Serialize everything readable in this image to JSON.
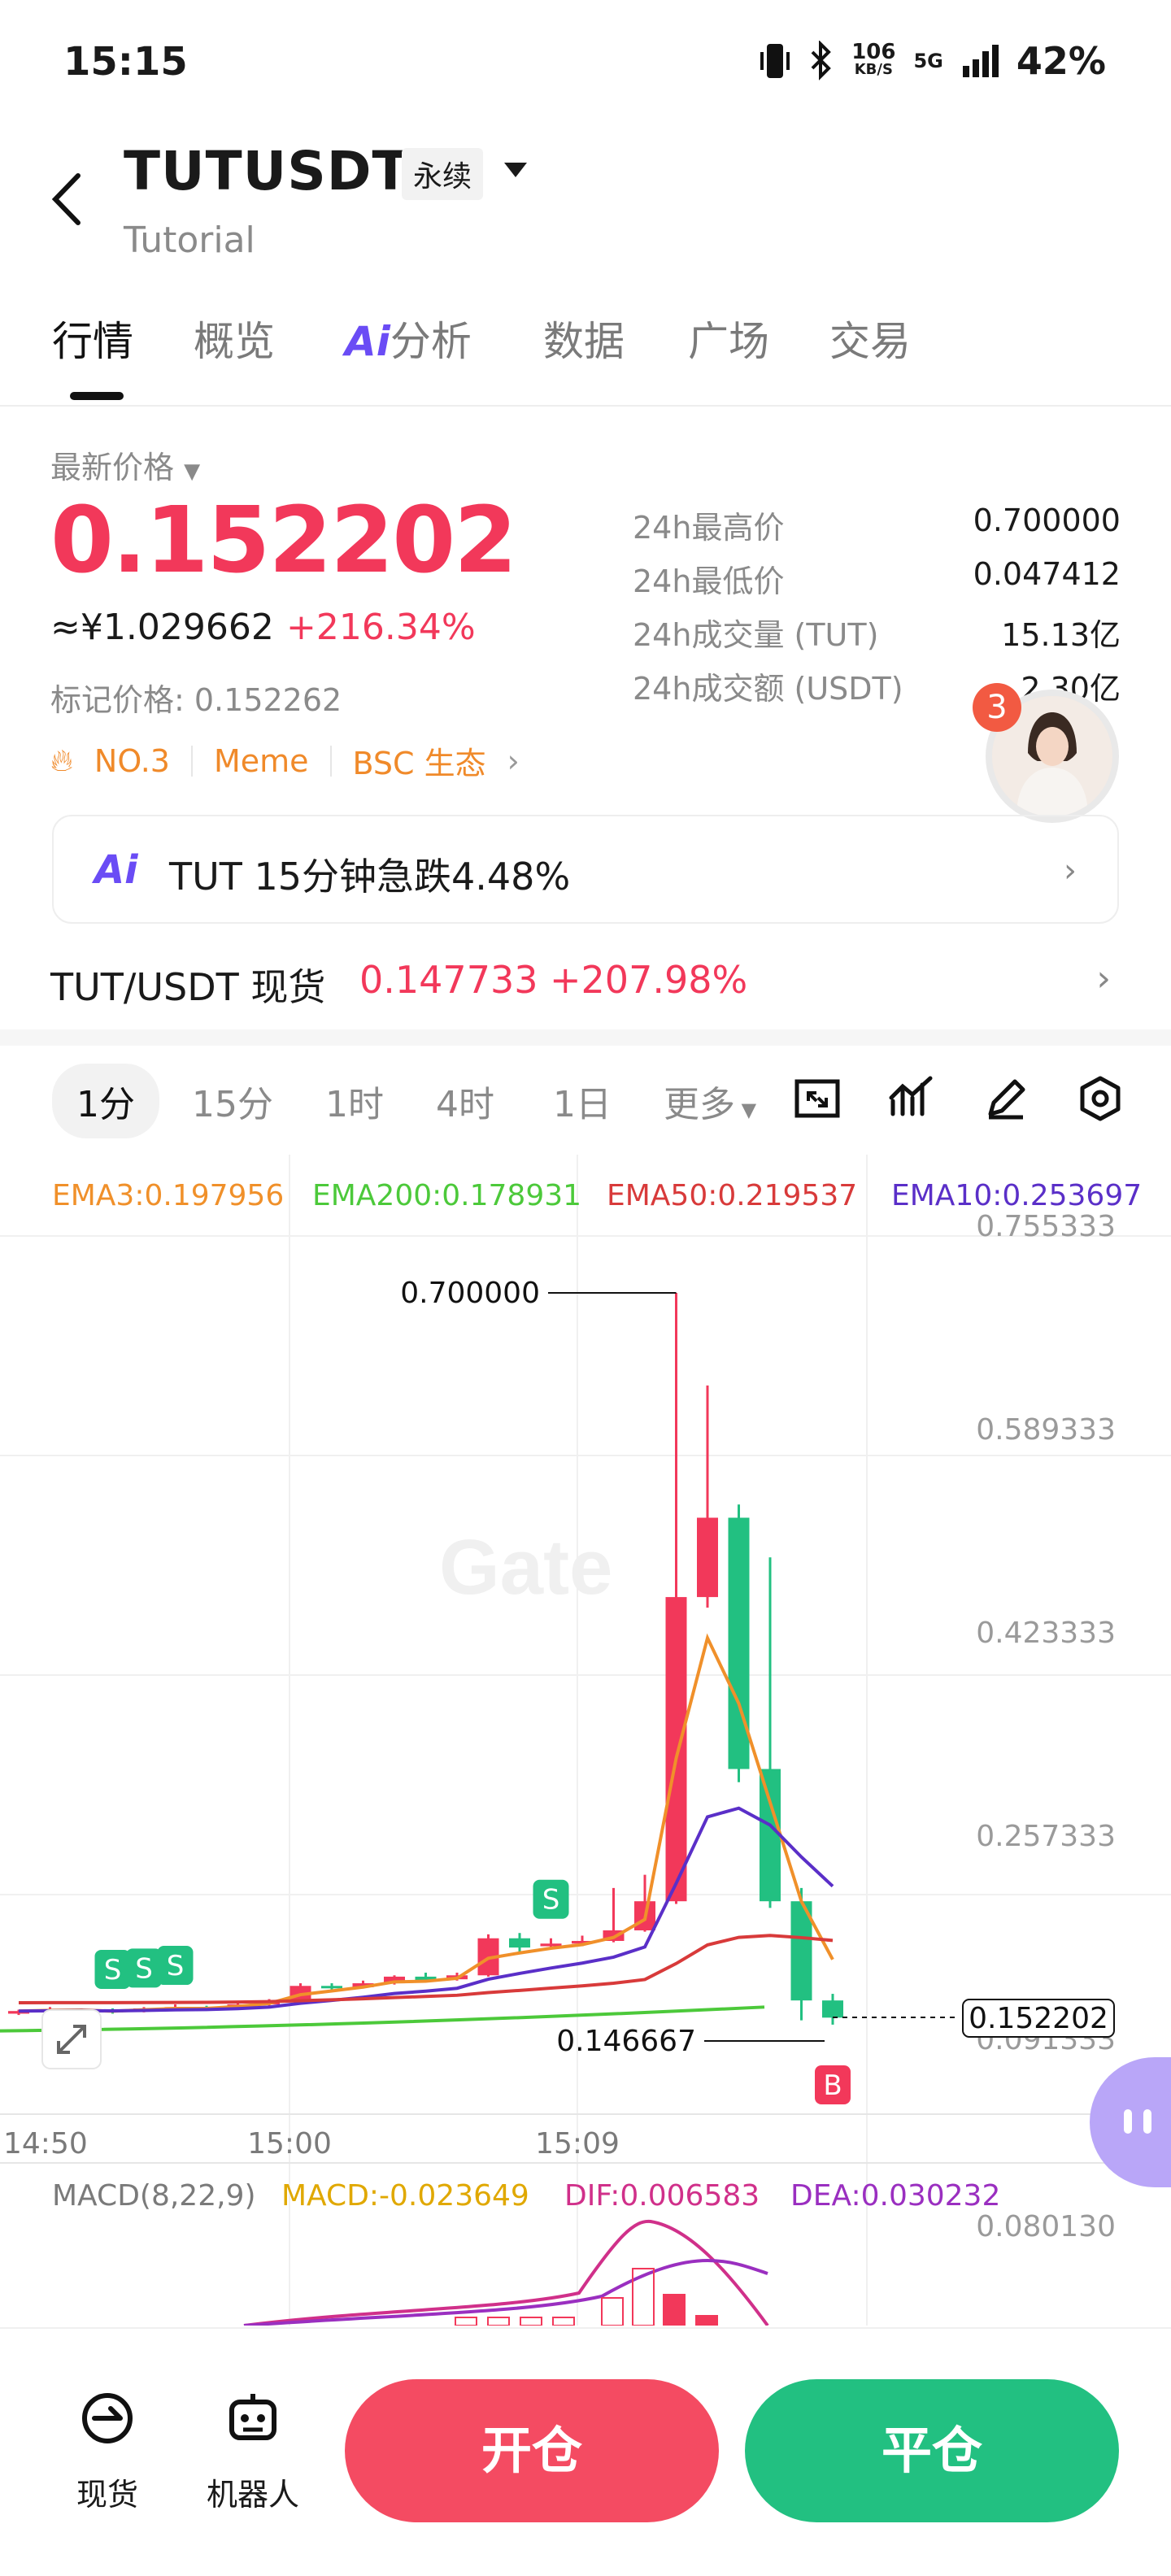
{
  "status": {
    "time": "15:15",
    "netspeed_value": "106",
    "netspeed_unit": "KB/S",
    "network": "5G",
    "battery": "42%"
  },
  "header": {
    "title": "TUTUSDT",
    "contract_type": "永续",
    "subtitle": "Tutorial"
  },
  "tabs": [
    {
      "label": "行情",
      "active": true
    },
    {
      "label": "概览"
    },
    {
      "label": "分析",
      "prefix": "Ai"
    },
    {
      "label": "数据"
    },
    {
      "label": "广场"
    },
    {
      "label": "交易"
    }
  ],
  "price": {
    "latest_label": "最新价格",
    "latest": "0.152202",
    "cny": "≈¥1.029662",
    "change": "+216.34%",
    "mark_label": "标记价格: 0.152262",
    "tags": [
      "NO.3",
      "Meme",
      "BSC 生态"
    ],
    "stats": [
      {
        "k": "24h最高价",
        "v": "0.700000"
      },
      {
        "k": "24h最低价",
        "v": "0.047412"
      },
      {
        "k": "24h成交量 (TUT)",
        "v": "15.13亿"
      },
      {
        "k": "24h成交额 (USDT)",
        "v": "2.30亿"
      }
    ]
  },
  "ai_notice": {
    "logo": "Ai",
    "text": "TUT 15分钟急跌4.48%"
  },
  "spot": {
    "name": "TUT/USDT 现货",
    "price": "0.147733",
    "change": "+207.98%"
  },
  "badge_count": "3",
  "intervals": [
    "1分",
    "15分",
    "1时",
    "4时",
    "1日",
    "更多"
  ],
  "chart_data": {
    "type": "candlestick",
    "ema_legend": [
      {
        "name": "EMA3",
        "value": "0.197956",
        "color": "#f0902a"
      },
      {
        "name": "EMA200",
        "value": "0.178931",
        "color": "#4cc93a"
      },
      {
        "name": "EMA50",
        "value": "0.219537",
        "color": "#d83a3a"
      },
      {
        "name": "EMA10",
        "value": "0.253697",
        "color": "#5a2fc8"
      }
    ],
    "y_ticks": [
      "0.755333",
      "0.589333",
      "0.423333",
      "0.257333",
      "0.091333"
    ],
    "y_range": [
      0.091333,
      0.755333
    ],
    "x_ticks": [
      "14:50",
      "15:00",
      "15:09"
    ],
    "high_label": "0.700000",
    "low_label": "0.146667",
    "last_price_label": "0.152202",
    "watermark": "Gate",
    "candles": [
      {
        "o": 0.155,
        "c": 0.157,
        "h": 0.158,
        "l": 0.154
      },
      {
        "o": 0.156,
        "c": 0.158,
        "h": 0.16,
        "l": 0.155
      },
      {
        "o": 0.157,
        "c": 0.158,
        "h": 0.159,
        "l": 0.156
      },
      {
        "o": 0.158,
        "c": 0.156,
        "h": 0.159,
        "l": 0.155
      },
      {
        "o": 0.157,
        "c": 0.159,
        "h": 0.16,
        "l": 0.156
      },
      {
        "o": 0.158,
        "c": 0.16,
        "h": 0.162,
        "l": 0.157
      },
      {
        "o": 0.16,
        "c": 0.159,
        "h": 0.161,
        "l": 0.158
      },
      {
        "o": 0.16,
        "c": 0.162,
        "h": 0.163,
        "l": 0.159
      },
      {
        "o": 0.162,
        "c": 0.165,
        "h": 0.166,
        "l": 0.161
      },
      {
        "o": 0.165,
        "c": 0.176,
        "h": 0.178,
        "l": 0.164
      },
      {
        "o": 0.176,
        "c": 0.175,
        "h": 0.178,
        "l": 0.173
      },
      {
        "o": 0.175,
        "c": 0.178,
        "h": 0.18,
        "l": 0.174
      },
      {
        "o": 0.178,
        "c": 0.183,
        "h": 0.184,
        "l": 0.177
      },
      {
        "o": 0.183,
        "c": 0.18,
        "h": 0.186,
        "l": 0.179
      },
      {
        "o": 0.181,
        "c": 0.184,
        "h": 0.186,
        "l": 0.18
      },
      {
        "o": 0.184,
        "c": 0.212,
        "h": 0.215,
        "l": 0.183
      },
      {
        "o": 0.212,
        "c": 0.205,
        "h": 0.216,
        "l": 0.202
      },
      {
        "o": 0.206,
        "c": 0.208,
        "h": 0.212,
        "l": 0.204
      },
      {
        "o": 0.208,
        "c": 0.21,
        "h": 0.214,
        "l": 0.206
      },
      {
        "o": 0.21,
        "c": 0.218,
        "h": 0.25,
        "l": 0.209
      },
      {
        "o": 0.218,
        "c": 0.24,
        "h": 0.26,
        "l": 0.217
      },
      {
        "o": 0.24,
        "c": 0.47,
        "h": 0.7,
        "l": 0.238
      },
      {
        "o": 0.47,
        "c": 0.53,
        "h": 0.63,
        "l": 0.462
      },
      {
        "o": 0.53,
        "c": 0.34,
        "h": 0.54,
        "l": 0.33
      },
      {
        "o": 0.34,
        "c": 0.24,
        "h": 0.5,
        "l": 0.235
      },
      {
        "o": 0.24,
        "c": 0.165,
        "h": 0.25,
        "l": 0.15
      },
      {
        "o": 0.165,
        "c": 0.152,
        "h": 0.17,
        "l": 0.1467
      }
    ],
    "markers": [
      {
        "label": "S",
        "candle": 3
      },
      {
        "label": "S",
        "candle": 4
      },
      {
        "label": "S",
        "candle": 5
      },
      {
        "label": "S",
        "candle": 17
      },
      {
        "label": "B",
        "candle": 26
      }
    ],
    "macd": {
      "label": "MACD(8,22,9)",
      "macd": "MACD:-0.023649",
      "dif": "DIF:0.006583",
      "dea": "DEA:0.030232",
      "tick": "0.080130"
    }
  },
  "bottom": {
    "spot_label": "现货",
    "robot_label": "机器人",
    "open_label": "开仓",
    "close_label": "平仓"
  }
}
